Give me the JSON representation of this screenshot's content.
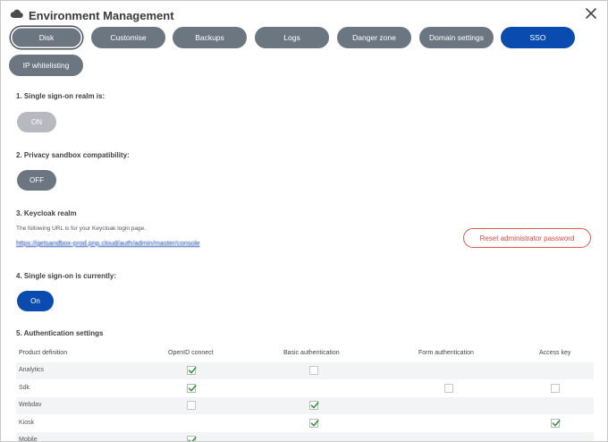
{
  "window": {
    "title": "Environment Management",
    "icon": "cloud-icon",
    "close_icon": "close-icon"
  },
  "tabs": [
    {
      "label": "Disk",
      "state": "selected"
    },
    {
      "label": "Customise",
      "state": "normal"
    },
    {
      "label": "Backups",
      "state": "normal"
    },
    {
      "label": "Logs",
      "state": "normal"
    },
    {
      "label": "Danger zone",
      "state": "normal"
    },
    {
      "label": "Domain settings",
      "state": "normal"
    },
    {
      "label": "SSO",
      "state": "active"
    },
    {
      "label": "IP whitelisting",
      "state": "normal"
    }
  ],
  "sections": {
    "realm": {
      "label": "1. Single sign-on realm is:",
      "toggle": "ON"
    },
    "privacy": {
      "label": "2. Privacy sandbox compatibility:",
      "toggle": "OFF"
    },
    "keycloak": {
      "label": "3. Keycloak realm",
      "helper": "The following URL is for your Keycloak login page.",
      "url": "https://getsandbox-prod.pnp.cloud/auth/admin/master/console",
      "reset_label": "Reset administrator password"
    },
    "sso_state": {
      "label": "4. Single sign-on is currently:",
      "toggle": "On"
    },
    "auth": {
      "label": "5. Authentication settings"
    }
  },
  "auth_table": {
    "headers": [
      "Product definition",
      "OpenID connect",
      "Basic authentication",
      "Form authentication",
      "Access key"
    ],
    "rows": [
      {
        "name": "Analytics",
        "cells": [
          "checked",
          "unchecked",
          "none",
          "none"
        ]
      },
      {
        "name": "Sdk",
        "cells": [
          "checked",
          "none",
          "unchecked",
          "unchecked"
        ]
      },
      {
        "name": "Webdav",
        "cells": [
          "unchecked",
          "checked",
          "none",
          "none"
        ]
      },
      {
        "name": "Kiosk",
        "cells": [
          "none",
          "checked",
          "none",
          "checked"
        ]
      },
      {
        "name": "Mobile",
        "cells": [
          "checked",
          "none",
          "none",
          "none"
        ]
      }
    ]
  },
  "colors": {
    "tab_bg": "#6c7681",
    "tab_active": "#0a4bb0",
    "toggle_disabled": "#b6b9bd",
    "danger": "#e0584f",
    "check": "#2e9a3e"
  }
}
